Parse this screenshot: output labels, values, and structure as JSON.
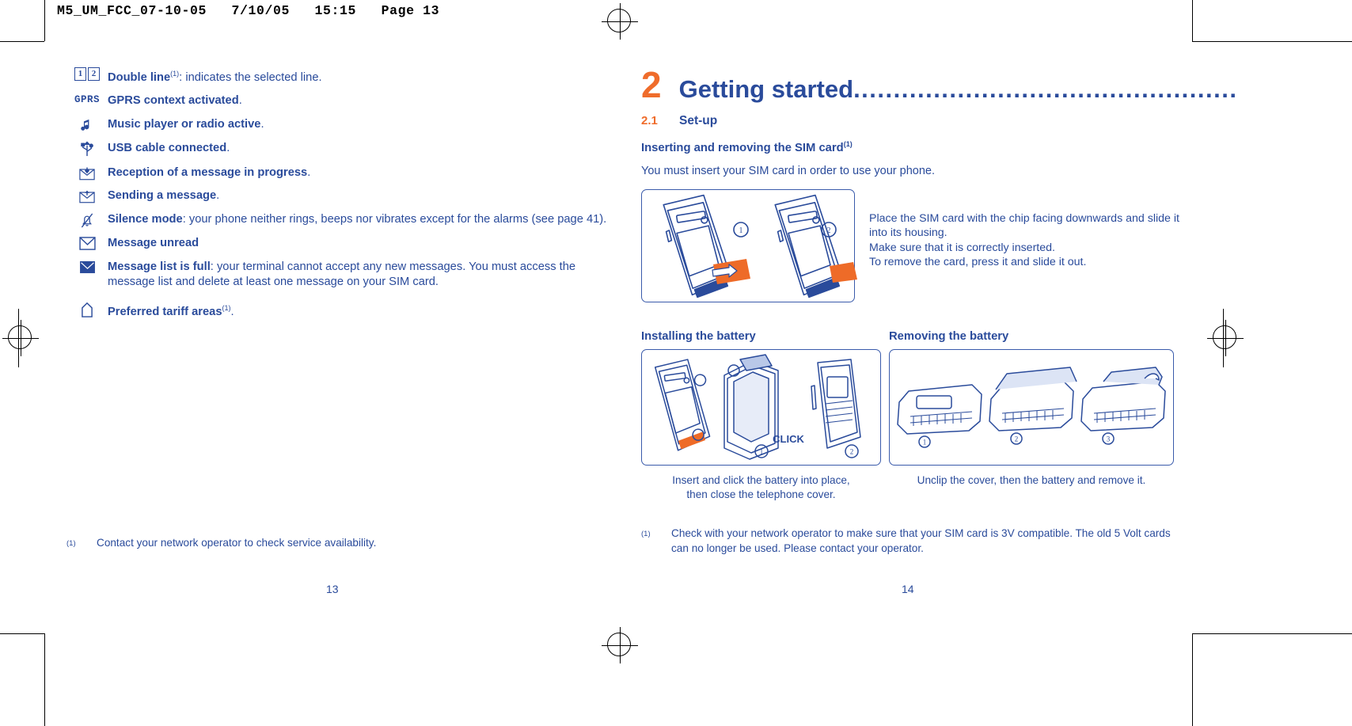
{
  "slug": "M5_UM_FCC_07-10-05   7/10/05   15:15   Page 13",
  "colors": {
    "blue": "#2a4b9b",
    "orange": "#ef6c2b",
    "figure_border": "#3a5bab",
    "black": "#000000"
  },
  "left_page": {
    "folio": "13",
    "icon_list": [
      {
        "icon": "double-line-icon",
        "title": "Double line",
        "sup": "(1)",
        "rest": ": indicates the selected line."
      },
      {
        "icon": "gprs-icon",
        "title": "GPRS context activated",
        "sup": "",
        "rest": "."
      },
      {
        "icon": "music-note-icon",
        "title": "Music player or radio active",
        "sup": "",
        "rest": "."
      },
      {
        "icon": "usb-icon",
        "title": "USB cable connected",
        "sup": "",
        "rest": "."
      },
      {
        "icon": "envelope-download-icon",
        "title": "Reception of a message in progress",
        "sup": "",
        "rest": "."
      },
      {
        "icon": "envelope-upload-icon",
        "title": "Sending a message",
        "sup": "",
        "rest": "."
      },
      {
        "icon": "bell-crossed-icon",
        "title": "Silence mode",
        "sup": "",
        "rest": ": your phone neither rings, beeps nor vibrates except for the alarms (see page 41)."
      },
      {
        "icon": "envelope-outline-icon",
        "title": "Message unread",
        "sup": "",
        "rest": ""
      },
      {
        "icon": "envelope-filled-icon",
        "title": "Message list is full",
        "sup": "",
        "rest": ": your terminal cannot accept any new messages. You must access the message list and delete at least one message on your SIM card."
      },
      {
        "icon": "home-tariff-icon",
        "title": "Preferred tariff areas",
        "sup": "(1)",
        "rest": "."
      }
    ],
    "footnote": {
      "marker": "(1)",
      "text": "Contact your network operator to check service availability."
    }
  },
  "right_page": {
    "folio": "14",
    "chapter_number": "2",
    "chapter_title": "Getting started",
    "chapter_dots": "................................................",
    "section": {
      "number": "2.1",
      "title": "Set-up"
    },
    "subheading": "Inserting and removing the SIM card",
    "subheading_sup": "(1)",
    "intro": "You must insert your SIM card in order to use your phone.",
    "sim_figure": {
      "name": "sim-insert-figure",
      "step_labels": [
        "1",
        "2"
      ]
    },
    "sim_instructions": "Place the SIM card with the chip facing downwards and slide it into its housing.\nMake sure that it is correctly inserted.\nTo remove the card, press it and slide it out.",
    "battery_install": {
      "heading": "Installing the battery",
      "figure_name": "battery-install-figure",
      "click_label": "CLICK",
      "step_labels": [
        "1",
        "2"
      ],
      "caption": "Insert and click the battery into place,\nthen close the telephone cover."
    },
    "battery_remove": {
      "heading": "Removing the battery",
      "figure_name": "battery-remove-figure",
      "step_labels": [
        "1",
        "2",
        "3"
      ],
      "caption": "Unclip the cover, then the battery and remove it."
    },
    "footnote": {
      "marker": "(1)",
      "text": "Check with your network operator to make sure that your SIM card is 3V compatible. The old 5 Volt cards can no longer be used. Please contact your operator."
    }
  }
}
